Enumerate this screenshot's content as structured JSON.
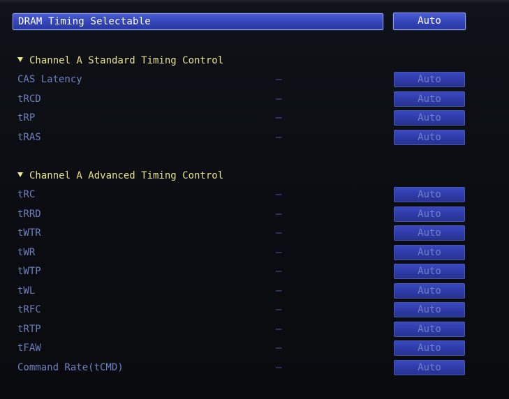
{
  "header": {
    "title": "DRAM Timing Selectable",
    "value": "Auto"
  },
  "sections": [
    {
      "title": "Channel A Standard Timing Control",
      "rows": [
        {
          "label": "CAS Latency",
          "dash": "–",
          "value": "Auto"
        },
        {
          "label": "tRCD",
          "dash": "–",
          "value": "Auto"
        },
        {
          "label": "tRP",
          "dash": "–",
          "value": "Auto"
        },
        {
          "label": "tRAS",
          "dash": "–",
          "value": "Auto"
        }
      ]
    },
    {
      "title": "Channel A Advanced Timing Control",
      "rows": [
        {
          "label": "tRC",
          "dash": "–",
          "value": "Auto"
        },
        {
          "label": "tRRD",
          "dash": "–",
          "value": "Auto"
        },
        {
          "label": "tWTR",
          "dash": "–",
          "value": "Auto"
        },
        {
          "label": "tWR",
          "dash": "–",
          "value": "Auto"
        },
        {
          "label": "tWTP",
          "dash": "–",
          "value": "Auto"
        },
        {
          "label": "tWL",
          "dash": "–",
          "value": "Auto"
        },
        {
          "label": "tRFC",
          "dash": "–",
          "value": "Auto"
        },
        {
          "label": "tRTP",
          "dash": "–",
          "value": "Auto"
        },
        {
          "label": "tFAW",
          "dash": "–",
          "value": "Auto"
        },
        {
          "label": "Command Rate(tCMD)",
          "dash": "–",
          "value": "Auto"
        }
      ]
    }
  ],
  "colors": {
    "section_title": "#e6e08a",
    "label": "#6e80bc",
    "selected_bar": "#3344b8",
    "button": "#2e3aa6"
  }
}
